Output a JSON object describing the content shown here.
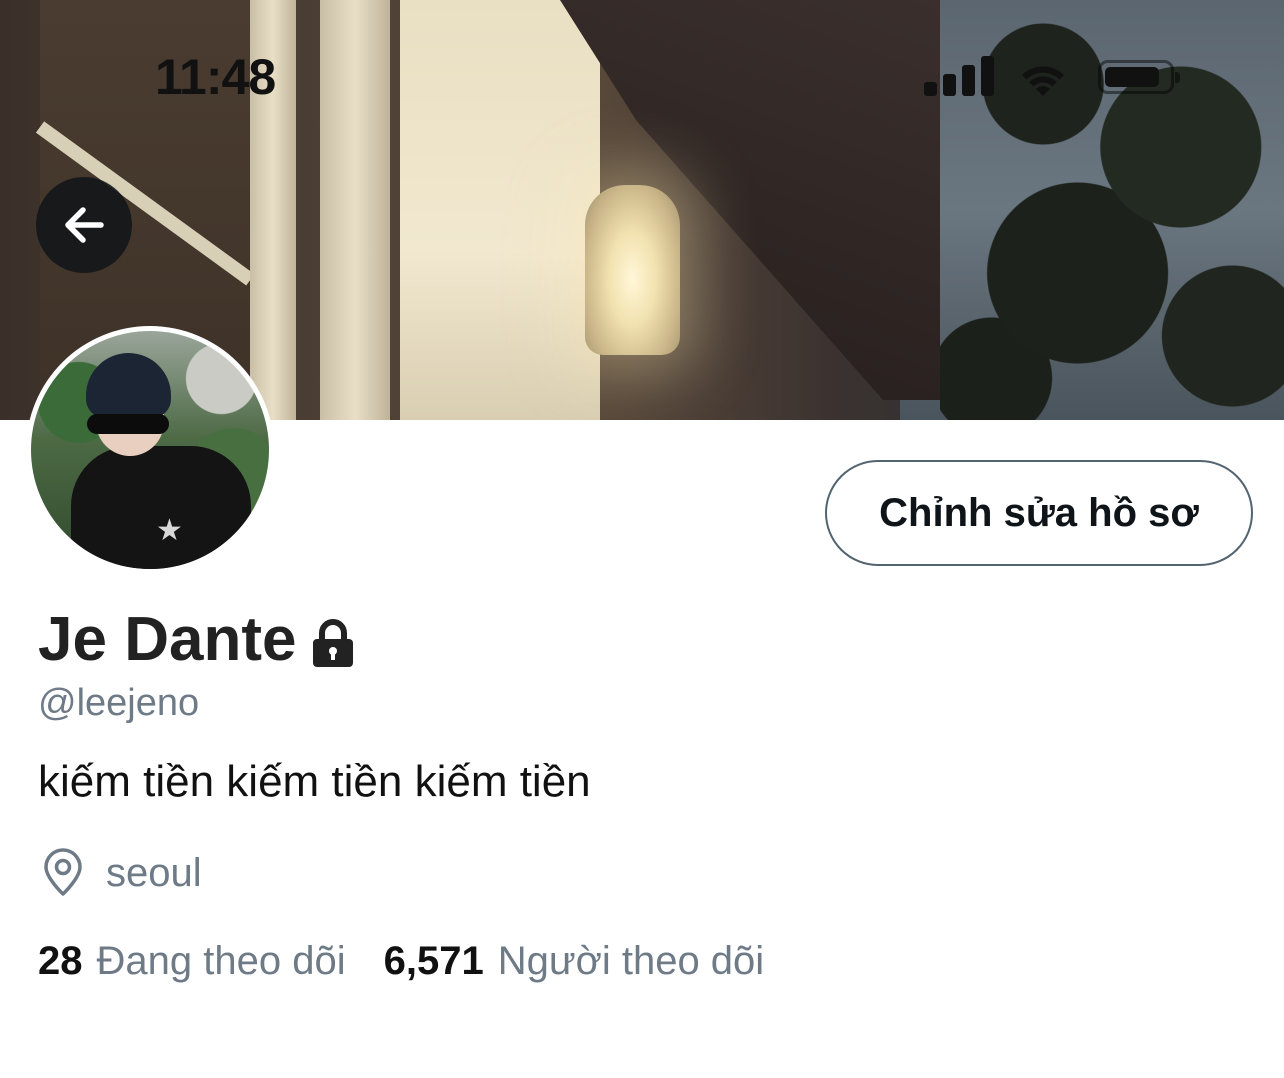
{
  "status_bar": {
    "time": "11:48"
  },
  "header": {
    "back_icon": "arrow-left-icon"
  },
  "profile": {
    "display_name": "Je Dante",
    "protected_icon": "lock-icon",
    "handle": "@leejeno",
    "bio": "kiếm tiền kiếm tiền kiếm tiền",
    "location_icon": "location-pin-icon",
    "location": "seoul",
    "edit_button_label": "Chỉnh sửa hồ sơ"
  },
  "stats": {
    "following_count": "28",
    "following_label": "Đang theo dõi",
    "followers_count": "6,571",
    "followers_label": "Người theo dõi"
  },
  "colors": {
    "text_primary": "#0f1419",
    "text_secondary": "#6e7b87",
    "button_border": "#536471",
    "background": "#ffffff"
  }
}
